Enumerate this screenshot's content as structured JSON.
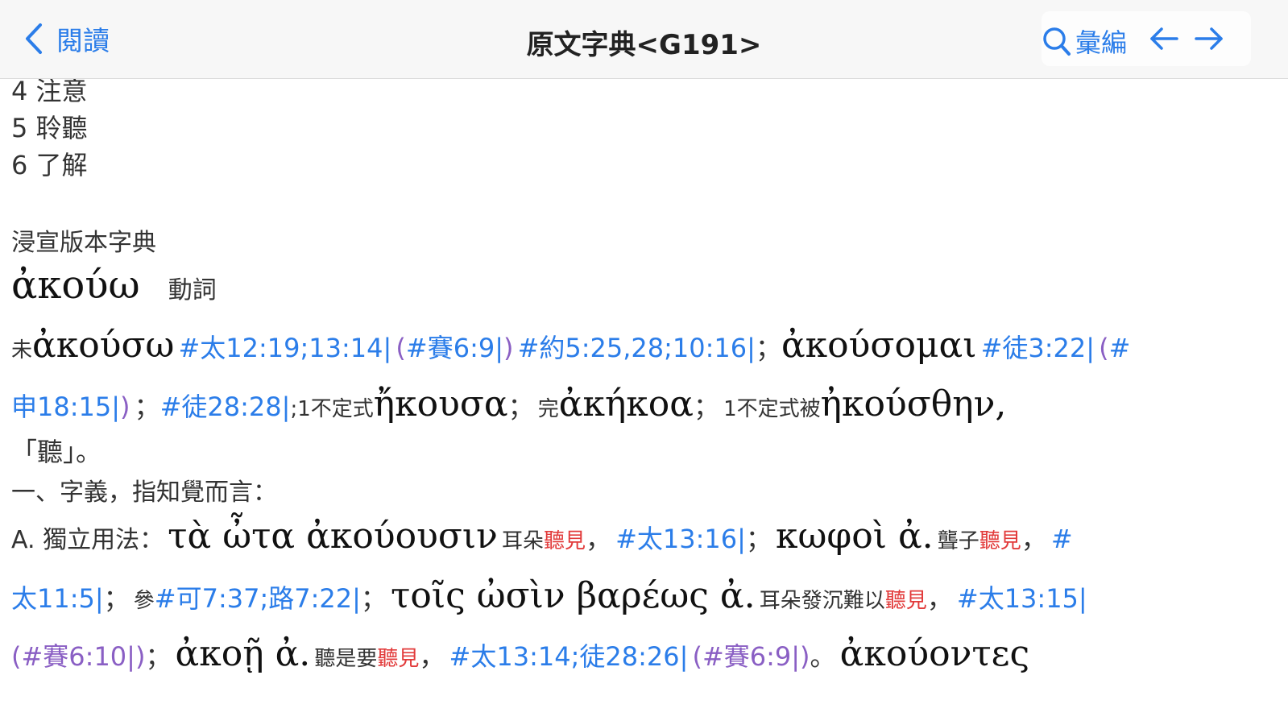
{
  "header": {
    "back_label": "閱讀",
    "title": "原文字典<G191>",
    "lookup_label": "彙編"
  },
  "meanings": [
    "4 注意",
    "5 聆聽",
    "6 了解"
  ],
  "section_title": "浸宣版本字典",
  "entry": {
    "headword": "ἀκούω",
    "pos": "動詞"
  },
  "forms": {
    "fut_prefix": "未",
    "fut_word": "ἀκούσω",
    "ref1": "#太12:19;13:14|",
    "ref2_open": "(",
    "ref2": "#賽6:9|",
    "ref2_close": ")",
    "ref3": "#約5:25,28;10:16|",
    "sep1": "；",
    "fut_mid_word": "ἀκούσομαι",
    "ref4": "#徒3:22|",
    "ref5_open": "(",
    "ref5_a": "#",
    "ref5_b": "申18:15|",
    "ref5_close": ")",
    "sep2": "；",
    "ref6": "#徒28:28|",
    "aor_prefix": ";1不定式",
    "aor_word": "ἤκουσα",
    "sep3": "；",
    "perf_prefix": "完",
    "perf_word": "ἀκήκοα",
    "sep4": "；",
    "aorp_prefix": "1不定式被",
    "aorp_word": "ἠκούσθην,",
    "gloss_open": "「",
    "gloss_word": "聽",
    "gloss_close": "」。"
  },
  "sense_title": "一、字義，指知覺而言：",
  "usage": {
    "label": "A. 獨立用法：",
    "ex1": "τὰ ὦτα ἀκούουσιν",
    "ex1_gloss_a": "耳朵",
    "ex1_gloss_b": "聽見",
    "comma1": "，",
    "ex1_ref": "#太13:16|",
    "semi1": "；",
    "ex2": "κωφοὶ ἀ.",
    "ex2_gloss_a": "聾子",
    "ex2_gloss_b": "聽見",
    "comma2": "，",
    "ex2_ref_a": "#",
    "ex2_ref_b": "太11:5|",
    "semi2": "；",
    "see": "參",
    "ex2_ref_c": "#可7:37;路7:22|",
    "semi3": "；",
    "ex3": "τοῖς ὠσὶν βαρέως ἀ.",
    "ex3_gloss_a": "耳朵發沉難以",
    "ex3_gloss_b": "聽見",
    "comma3": "，",
    "ex3_ref": "#太13:15|",
    "ex3_pref": "(#賽6:10|)",
    "semi4": "；",
    "ex4": "ἀκοῇ ἀ.",
    "ex4_gloss_a": "聽是要",
    "ex4_gloss_b": "聽見",
    "comma4": "，",
    "ex4_ref": "#太13:14;徒28:26|",
    "ex4_pref": "(#賽6:9|)",
    "period": "。",
    "ex5": "ἀκούοντες"
  },
  "colors": {
    "accent": "#2b7de9",
    "highlight": "#e23b3b",
    "paren_ref": "#8a5fc4"
  },
  "icons": [
    "chevron-left-icon",
    "search-icon",
    "arrow-left-icon",
    "arrow-right-icon"
  ]
}
